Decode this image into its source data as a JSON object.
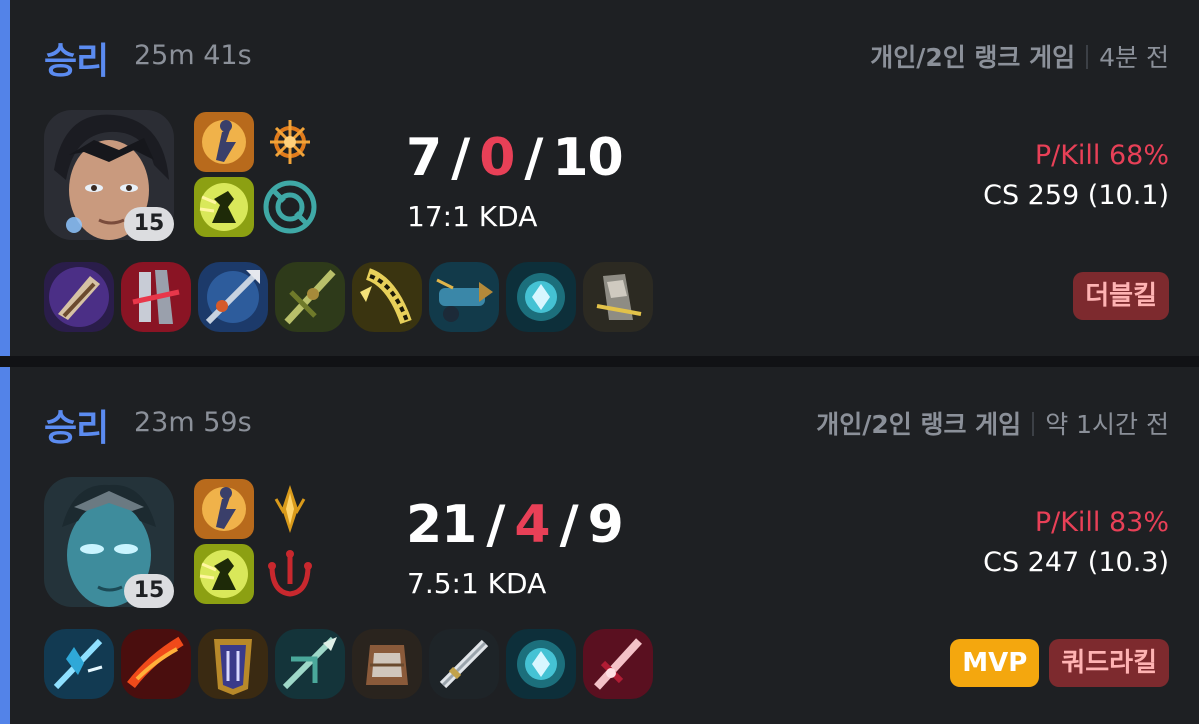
{
  "matches": [
    {
      "result": "승리",
      "duration": "25m 41s",
      "queue": "개인/2인 랭크 게임",
      "time_ago": "4분 전",
      "level": "15",
      "kda": {
        "kills": "7",
        "deaths": "0",
        "assists": "10"
      },
      "kda_ratio": "17:1 KDA",
      "pkill": "P/Kill 68%",
      "cs": "CS 259 (10.1)",
      "badges": [
        "더블킬"
      ],
      "items": [
        "item-1",
        "item-2",
        "item-3",
        "item-4",
        "item-5",
        "item-6",
        "item-7",
        "item-8"
      ]
    },
    {
      "result": "승리",
      "duration": "23m 59s",
      "queue": "개인/2인 랭크 게임",
      "time_ago": "약 1시간 전",
      "level": "15",
      "kda": {
        "kills": "21",
        "deaths": "4",
        "assists": "9"
      },
      "kda_ratio": "7.5:1 KDA",
      "pkill": "P/Kill 83%",
      "cs": "CS 247 (10.3)",
      "badges": [
        "MVP",
        "쿼드라킬"
      ],
      "items": [
        "item-1",
        "item-2",
        "item-3",
        "item-4",
        "item-5",
        "item-6",
        "item-7",
        "item-8"
      ]
    }
  ],
  "colors": {
    "win": "#5b8bf0",
    "accent_bar": "#5383e8",
    "death": "#e84057",
    "pkill": "#e84057",
    "mvp": "#f4a70e",
    "multikill_bg": "#7d2a2e",
    "card_bg": "#1e2023"
  }
}
